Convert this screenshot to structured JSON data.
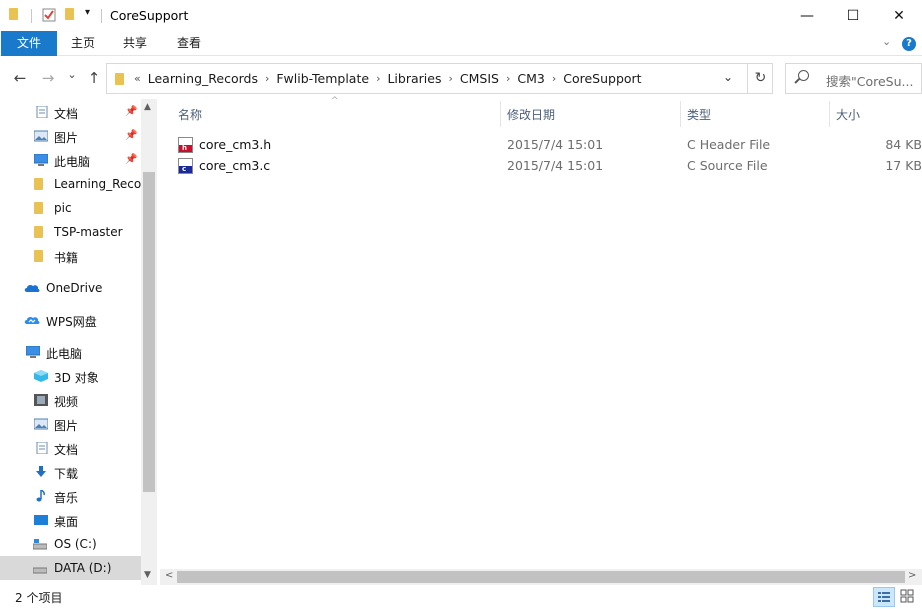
{
  "window": {
    "title": "CoreSupport",
    "minimize_glyph": "—",
    "maximize_glyph": "☐",
    "close_glyph": "✕"
  },
  "ribbon": {
    "tabs": [
      {
        "label": "文件",
        "active": true
      },
      {
        "label": "主页",
        "active": false
      },
      {
        "label": "共享",
        "active": false
      },
      {
        "label": "查看",
        "active": false
      }
    ],
    "expand_glyph": "⌄",
    "help_glyph": "?"
  },
  "nav": {
    "back_glyph": "←",
    "forward_glyph": "→",
    "recent_glyph": "⌄",
    "up_glyph": "↑",
    "overflow_glyph": "«",
    "separator_glyph": "›",
    "breadcrumbs": [
      "Learning_Records",
      "Fwlib-Template",
      "Libraries",
      "CMSIS",
      "CM3",
      "CoreSupport"
    ],
    "dropdown_glyph": "⌄",
    "refresh_glyph": "↻"
  },
  "search": {
    "placeholder": "搜索\"CoreSu..."
  },
  "sidebar": {
    "pin_glyph": "📌",
    "scroll_up_glyph": "▲",
    "scroll_down_glyph": "▼",
    "items": [
      {
        "label": "文档",
        "icon": "document-icon",
        "pinned": true
      },
      {
        "label": "图片",
        "icon": "pictures-icon",
        "pinned": true
      },
      {
        "label": "此电脑",
        "icon": "computer-icon",
        "pinned": true
      },
      {
        "label": "Learning_Records",
        "icon": "folder-icon",
        "pinned": false
      },
      {
        "label": "pic",
        "icon": "folder-icon",
        "pinned": false
      },
      {
        "label": "TSP-master",
        "icon": "folder-icon",
        "pinned": false
      },
      {
        "label": "书籍",
        "icon": "folder-icon",
        "pinned": false
      },
      {
        "label": "OneDrive",
        "icon": "onedrive-icon",
        "pinned": false
      },
      {
        "label": "WPS网盘",
        "icon": "wps-cloud-icon",
        "pinned": false
      },
      {
        "label": "此电脑",
        "icon": "computer-icon",
        "pinned": false
      },
      {
        "label": "3D 对象",
        "icon": "3d-objects-icon",
        "pinned": false
      },
      {
        "label": "视频",
        "icon": "video-icon",
        "pinned": false
      },
      {
        "label": "图片",
        "icon": "pictures-icon",
        "pinned": false
      },
      {
        "label": "文档",
        "icon": "document-icon",
        "pinned": false
      },
      {
        "label": "下载",
        "icon": "download-icon",
        "pinned": false
      },
      {
        "label": "音乐",
        "icon": "music-icon",
        "pinned": false
      },
      {
        "label": "桌面",
        "icon": "desktop-icon",
        "pinned": false
      },
      {
        "label": "OS (C:)",
        "icon": "drive-c-icon",
        "pinned": false
      },
      {
        "label": "DATA (D:)",
        "icon": "drive-d-icon",
        "pinned": false,
        "selected": true
      }
    ]
  },
  "filelist": {
    "sort_glyph": "^",
    "columns": [
      "名称",
      "修改日期",
      "类型",
      "大小"
    ],
    "files": [
      {
        "name": "core_cm3.h",
        "date": "2015/7/4 15:01",
        "type": "C Header File",
        "size": "84 KB",
        "icon": "c-header-file-icon",
        "badge": "h",
        "badge_color": "#c8102e"
      },
      {
        "name": "core_cm3.c",
        "date": "2015/7/4 15:01",
        "type": "C Source File",
        "size": "17 KB",
        "icon": "c-source-file-icon",
        "badge": "c",
        "badge_color": "#1a2a9a"
      }
    ],
    "hscroll_left_glyph": "<",
    "hscroll_right_glyph": ">"
  },
  "statusbar": {
    "item_count": "2 个项目"
  },
  "colors": {
    "accent": "#1979ca",
    "header_text": "#4c607a",
    "folder": "#e8bf4f",
    "selection": "#d9d9d9"
  }
}
